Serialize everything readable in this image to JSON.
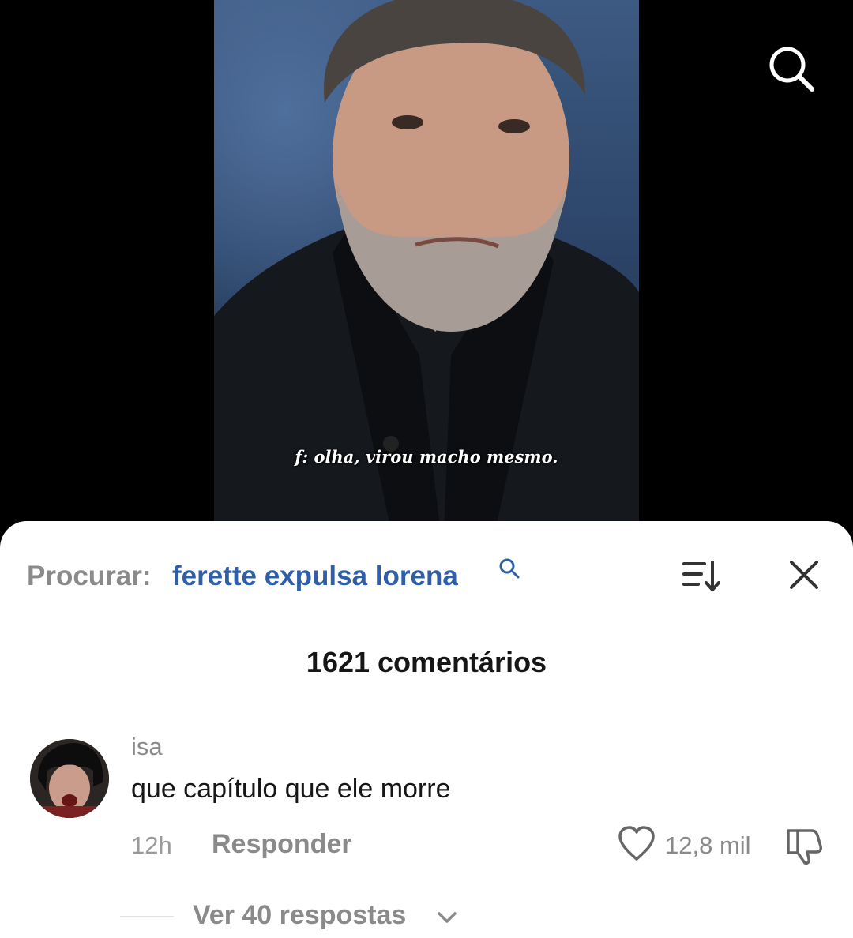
{
  "video": {
    "subtitle": "f: olha, virou macho mesmo."
  },
  "top_bar": {
    "search_icon": "search-icon"
  },
  "comments_sheet": {
    "search_prefix": "Procurar:",
    "search_term": "ferette expulsa lorena",
    "search_term_icon": "search-icon",
    "sort_icon": "sort-icon",
    "close_icon": "close-icon",
    "comment_count": "1621 comentários",
    "comments": [
      {
        "username": "isa",
        "text": "que capítulo que ele morre",
        "time": "12h",
        "reply_label": "Responder",
        "likes": "12,8 mil",
        "view_replies": "Ver 40 respostas"
      }
    ]
  },
  "colors": {
    "link_blue": "#2f5fa8",
    "muted_gray": "#8a8a8a",
    "text_dark": "#161616"
  }
}
